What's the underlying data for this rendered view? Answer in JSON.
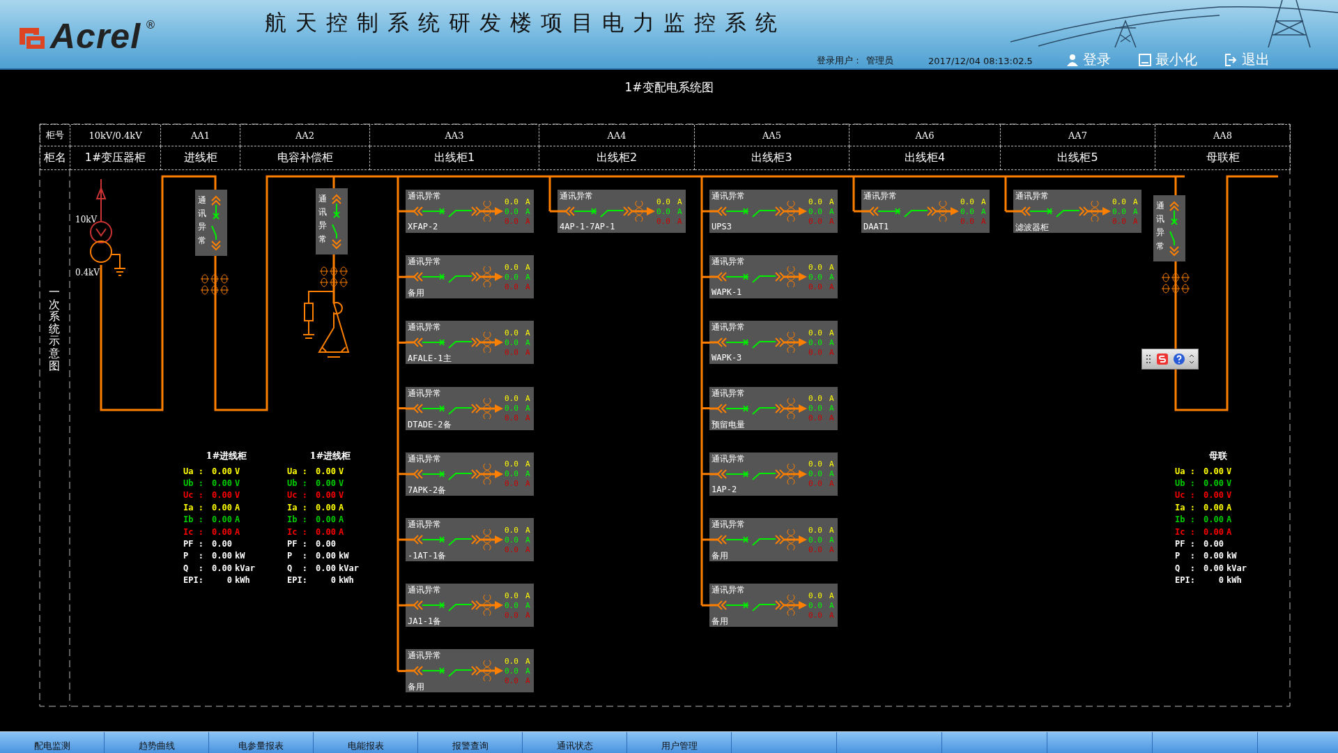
{
  "header": {
    "logo": "Acrel",
    "logo_mark": "®",
    "title": "航天控制系统研发楼项目电力监控系统",
    "user_label": "登录用户：",
    "user": "管理员",
    "datetime": "2017/12/04  08:13:02.5",
    "buttons": [
      {
        "label": "登录",
        "kind": "login"
      },
      {
        "label": "最小化",
        "kind": "minimize"
      },
      {
        "label": "退出",
        "kind": "exit"
      }
    ]
  },
  "diagram": {
    "title": "1#变配电系统图",
    "side_label": "一次系统示意图",
    "cabinet_table": {
      "row_labels": [
        "柜号",
        "柜名"
      ],
      "columns": [
        {
          "number": "10kV/0.4kV",
          "name": "1#变压器柜"
        },
        {
          "number": "AA1",
          "name": "进线柜"
        },
        {
          "number": "AA2",
          "name": "电容补偿柜"
        },
        {
          "number": "AA3",
          "name": "出线柜1"
        },
        {
          "number": "AA4",
          "name": "出线柜2"
        },
        {
          "number": "AA5",
          "name": "出线柜3"
        },
        {
          "number": "AA6",
          "name": "出线柜4"
        },
        {
          "number": "AA7",
          "name": "出线柜5"
        },
        {
          "number": "AA8",
          "name": "母联柜"
        }
      ]
    },
    "transformer": {
      "hv_label": "10kV",
      "lv_label": "0.4kV"
    },
    "status_boxes": [
      {
        "text": "通讯异常"
      },
      {
        "text": "通讯异常"
      },
      {
        "text": "通讯异常"
      }
    ],
    "feeder_columns": [
      {
        "feeders": [
          {
            "status": "通讯异常",
            "name": "XFAP-2",
            "readings": [
              {
                "value": "0.0",
                "unit": "A",
                "color": "#ffff00"
              },
              {
                "value": "0.0",
                "unit": "A",
                "color": "#00ff00"
              },
              {
                "value": "0.0",
                "unit": "A",
                "color": "#cc0000"
              }
            ]
          },
          {
            "status": "通讯异常",
            "name": "备用",
            "readings": [
              {
                "value": "0.0",
                "unit": "A",
                "color": "#ffff00"
              },
              {
                "value": "0.0",
                "unit": "A",
                "color": "#00ff00"
              },
              {
                "value": "0.0",
                "unit": "A",
                "color": "#cc0000"
              }
            ]
          },
          {
            "status": "通讯异常",
            "name": "AFALE-1主",
            "readings": [
              {
                "value": "0.0",
                "unit": "A",
                "color": "#ffff00"
              },
              {
                "value": "0.0",
                "unit": "A",
                "color": "#00ff00"
              },
              {
                "value": "0.0",
                "unit": "A",
                "color": "#cc0000"
              }
            ]
          },
          {
            "status": "通讯异常",
            "name": "DTADE-2备",
            "readings": [
              {
                "value": "0.0",
                "unit": "A",
                "color": "#ffff00"
              },
              {
                "value": "0.0",
                "unit": "A",
                "color": "#00ff00"
              },
              {
                "value": "0.0",
                "unit": "A",
                "color": "#cc0000"
              }
            ]
          },
          {
            "status": "通讯异常",
            "name": "7APK-2备",
            "readings": [
              {
                "value": "0.0",
                "unit": "A",
                "color": "#ffff00"
              },
              {
                "value": "0.0",
                "unit": "A",
                "color": "#00ff00"
              },
              {
                "value": "0.0",
                "unit": "A",
                "color": "#cc0000"
              }
            ]
          },
          {
            "status": "通讯异常",
            "name": "-1AT-1备",
            "readings": [
              {
                "value": "0.0",
                "unit": "A",
                "color": "#ffff00"
              },
              {
                "value": "0.0",
                "unit": "A",
                "color": "#00ff00"
              },
              {
                "value": "0.0",
                "unit": "A",
                "color": "#cc0000"
              }
            ]
          },
          {
            "status": "通讯异常",
            "name": "JA1-1备",
            "readings": [
              {
                "value": "0.0",
                "unit": "A",
                "color": "#ffff00"
              },
              {
                "value": "0.0",
                "unit": "A",
                "color": "#00ff00"
              },
              {
                "value": "0.0",
                "unit": "A",
                "color": "#cc0000"
              }
            ]
          },
          {
            "status": "通讯异常",
            "name": "备用",
            "readings": [
              {
                "value": "0.0",
                "unit": "A",
                "color": "#ffff00"
              },
              {
                "value": "0.0",
                "unit": "A",
                "color": "#00ff00"
              },
              {
                "value": "0.0",
                "unit": "A",
                "color": "#cc0000"
              }
            ]
          }
        ]
      },
      {
        "feeders": [
          {
            "status": "通讯异常",
            "name": "4AP-1-7AP-1",
            "readings": [
              {
                "value": "0.0",
                "unit": "A",
                "color": "#ffff00"
              },
              {
                "value": "0.0",
                "unit": "A",
                "color": "#00ff00"
              },
              {
                "value": "0.0",
                "unit": "A",
                "color": "#cc0000"
              }
            ]
          }
        ]
      },
      {
        "feeders": [
          {
            "status": "通讯异常",
            "name": "UPS3",
            "readings": [
              {
                "value": "0.0",
                "unit": "A",
                "color": "#ffff00"
              },
              {
                "value": "0.0",
                "unit": "A",
                "color": "#00ff00"
              },
              {
                "value": "0.0",
                "unit": "A",
                "color": "#cc0000"
              }
            ]
          },
          {
            "status": "通讯异常",
            "name": "WAPK-1",
            "readings": [
              {
                "value": "0.0",
                "unit": "A",
                "color": "#ffff00"
              },
              {
                "value": "0.0",
                "unit": "A",
                "color": "#00ff00"
              },
              {
                "value": "0.0",
                "unit": "A",
                "color": "#cc0000"
              }
            ]
          },
          {
            "status": "通讯异常",
            "name": "WAPK-3",
            "readings": [
              {
                "value": "0.0",
                "unit": "A",
                "color": "#ffff00"
              },
              {
                "value": "0.0",
                "unit": "A",
                "color": "#00ff00"
              },
              {
                "value": "0.0",
                "unit": "A",
                "color": "#cc0000"
              }
            ]
          },
          {
            "status": "通讯异常",
            "name": "预留电量",
            "readings": [
              {
                "value": "0.0",
                "unit": "A",
                "color": "#ffff00"
              },
              {
                "value": "0.0",
                "unit": "A",
                "color": "#00ff00"
              },
              {
                "value": "0.0",
                "unit": "A",
                "color": "#cc0000"
              }
            ]
          },
          {
            "status": "通讯异常",
            "name": "1AP-2",
            "readings": [
              {
                "value": "0.0",
                "unit": "A",
                "color": "#ffff00"
              },
              {
                "value": "0.0",
                "unit": "A",
                "color": "#00ff00"
              },
              {
                "value": "0.0",
                "unit": "A",
                "color": "#cc0000"
              }
            ]
          },
          {
            "status": "通讯异常",
            "name": "备用",
            "readings": [
              {
                "value": "0.0",
                "unit": "A",
                "color": "#ffff00"
              },
              {
                "value": "0.0",
                "unit": "A",
                "color": "#00ff00"
              },
              {
                "value": "0.0",
                "unit": "A",
                "color": "#cc0000"
              }
            ]
          },
          {
            "status": "通讯异常",
            "name": "备用",
            "readings": [
              {
                "value": "0.0",
                "unit": "A",
                "color": "#ffff00"
              },
              {
                "value": "0.0",
                "unit": "A",
                "color": "#00ff00"
              },
              {
                "value": "0.0",
                "unit": "A",
                "color": "#cc0000"
              }
            ]
          }
        ]
      },
      {
        "feeders": [
          {
            "status": "通讯异常",
            "name": "DAAT1",
            "readings": [
              {
                "value": "0.0",
                "unit": "A",
                "color": "#ffff00"
              },
              {
                "value": "0.0",
                "unit": "A",
                "color": "#00ff00"
              },
              {
                "value": "0.0",
                "unit": "A",
                "color": "#cc0000"
              }
            ]
          }
        ]
      },
      {
        "feeders": [
          {
            "status": "通讯异常",
            "name": "滤波器柜",
            "readings": [
              {
                "value": "0.0",
                "unit": "A",
                "color": "#ffff00"
              },
              {
                "value": "0.0",
                "unit": "A",
                "color": "#00ff00"
              },
              {
                "value": "0.0",
                "unit": "A",
                "color": "#cc0000"
              }
            ]
          }
        ]
      }
    ],
    "meters": [
      {
        "title": "1#进线柜",
        "rows": [
          {
            "label": "Ua :",
            "value": "0.00",
            "unit": "V",
            "color": "#ffff00"
          },
          {
            "label": "Ub :",
            "value": "0.00",
            "unit": "V",
            "color": "#00cc00"
          },
          {
            "label": "Uc :",
            "value": "0.00",
            "unit": "V",
            "color": "#ff0000"
          },
          {
            "label": "Ia :",
            "value": "0.00",
            "unit": "A",
            "color": "#ffff00"
          },
          {
            "label": "Ib :",
            "value": "0.00",
            "unit": "A",
            "color": "#00cc00"
          },
          {
            "label": "Ic :",
            "value": "0.00",
            "unit": "A",
            "color": "#ff0000"
          },
          {
            "label": "PF :",
            "value": "0.00",
            "color": "#ffffff"
          },
          {
            "label": "P  :",
            "value": "0.00",
            "unit": "kW",
            "color": "#ffffff"
          },
          {
            "label": "Q  :",
            "value": "0.00",
            "unit": "kVar",
            "color": "#ffffff"
          },
          {
            "label": "EPI:",
            "value": "0",
            "unit": "kWh",
            "color": "#ffffff"
          }
        ]
      },
      {
        "title": "1#进线柜",
        "rows": [
          {
            "label": "Ua :",
            "value": "0.00",
            "unit": "V",
            "color": "#ffff00"
          },
          {
            "label": "Ub :",
            "value": "0.00",
            "unit": "V",
            "color": "#00cc00"
          },
          {
            "label": "Uc :",
            "value": "0.00",
            "unit": "V",
            "color": "#ff0000"
          },
          {
            "label": "Ia :",
            "value": "0.00",
            "unit": "A",
            "color": "#ffff00"
          },
          {
            "label": "Ib :",
            "value": "0.00",
            "unit": "A",
            "color": "#00cc00"
          },
          {
            "label": "Ic :",
            "value": "0.00",
            "unit": "A",
            "color": "#ff0000"
          },
          {
            "label": "PF :",
            "value": "0.00",
            "color": "#ffffff"
          },
          {
            "label": "P  :",
            "value": "0.00",
            "unit": "kW",
            "color": "#ffffff"
          },
          {
            "label": "Q  :",
            "value": "0.00",
            "unit": "kVar",
            "color": "#ffffff"
          },
          {
            "label": "EPI:",
            "value": "0",
            "unit": "kWh",
            "color": "#ffffff"
          }
        ]
      },
      {
        "title": "母联",
        "rows": [
          {
            "label": "Ua :",
            "value": "0.00",
            "unit": "V",
            "color": "#ffff00"
          },
          {
            "label": "Ub :",
            "value": "0.00",
            "unit": "V",
            "color": "#00cc00"
          },
          {
            "label": "Uc :",
            "value": "0.00",
            "unit": "V",
            "color": "#ff0000"
          },
          {
            "label": "Ia :",
            "value": "0.00",
            "unit": "A",
            "color": "#ffff00"
          },
          {
            "label": "Ib :",
            "value": "0.00",
            "unit": "A",
            "color": "#00cc00"
          },
          {
            "label": "Ic :",
            "value": "0.00",
            "unit": "A",
            "color": "#ff0000"
          },
          {
            "label": "PF :",
            "value": "0.00",
            "color": "#ffffff"
          },
          {
            "label": "P  :",
            "value": "0.00",
            "unit": "kW",
            "color": "#ffffff"
          },
          {
            "label": "Q  :",
            "value": "0.00",
            "unit": "kVar",
            "color": "#ffffff"
          },
          {
            "label": "EPI:",
            "value": "0",
            "unit": "kWh",
            "color": "#ffffff"
          }
        ]
      }
    ]
  },
  "nav_tabs": [
    {
      "label": "配电监测"
    },
    {
      "label": "趋势曲线"
    },
    {
      "label": "电参量报表"
    },
    {
      "label": "电能报表"
    },
    {
      "label": "报警查询"
    },
    {
      "label": "通讯状态"
    },
    {
      "label": "用户管理"
    }
  ]
}
